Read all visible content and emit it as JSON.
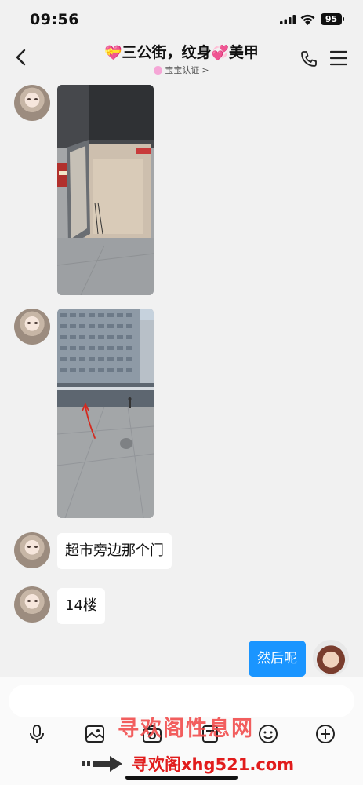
{
  "status_bar": {
    "time": "09:56",
    "battery": "95"
  },
  "header": {
    "title_part1": "三公街，纹身",
    "title_part2": "美甲",
    "subtitle": "宝宝认证"
  },
  "messages": [
    {
      "type": "image",
      "alt": "glass door entrance"
    },
    {
      "type": "image",
      "alt": "plaza with tall building"
    },
    {
      "type": "text",
      "text": "超市旁边那个门"
    },
    {
      "type": "text",
      "text": "14楼"
    },
    {
      "type": "text_me",
      "text": "然后呢"
    }
  ],
  "input": {
    "value": "",
    "placeholder": ""
  },
  "watermark": {
    "line1": "寻欢阁性息网",
    "line2": "寻欢阁xhg521.com"
  },
  "icons": [
    "back-icon",
    "phone-icon",
    "menu-icon",
    "mic-icon",
    "image-icon",
    "camera-icon",
    "gallery-icon",
    "emoji-icon",
    "add-icon"
  ]
}
